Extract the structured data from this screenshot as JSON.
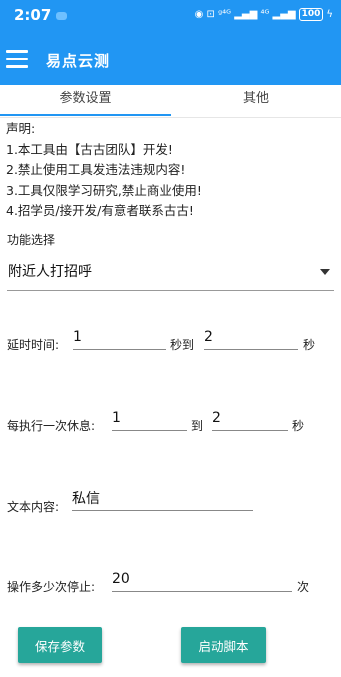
{
  "status": {
    "time": "2:07",
    "icons": "◉ ⊡ ᵍ⁴ᴳ ▂▄▆ ⁴ᴳ ▂▄▆",
    "battery": "100",
    "bolt": "ϟ"
  },
  "app": {
    "title": "易点云测"
  },
  "tabs": [
    {
      "label": "参数设置"
    },
    {
      "label": "其他"
    }
  ],
  "notice": {
    "lines": [
      "声明:",
      "1.本工具由【古古团队】开发!",
      "2.禁止使用工具发违法违规内容!",
      "3.工具仅限学习研究,禁止商业使用!",
      "4.招学员/接开发/有意者联系古古!"
    ]
  },
  "function": {
    "label": "功能选择",
    "selected": "附近人打招呼"
  },
  "delay": {
    "label": "延时时间:",
    "from": "1",
    "mid": "秒到",
    "to": "2",
    "unit": "秒"
  },
  "rest": {
    "label": "每执行一次休息:",
    "from": "1",
    "mid": "到",
    "to": "2",
    "unit": "秒"
  },
  "text": {
    "label": "文本内容:",
    "value": "私信"
  },
  "stop": {
    "label": "操作多少次停止:",
    "value": "20",
    "unit": "次"
  },
  "buttons": {
    "save": "保存参数",
    "start": "启动脚本"
  },
  "colors": {
    "primary": "#2196F3",
    "button": "#26A69A"
  }
}
